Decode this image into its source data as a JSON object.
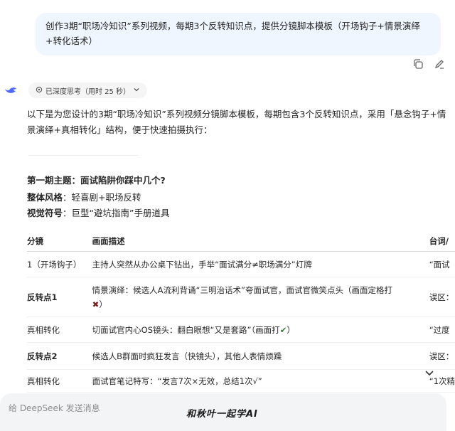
{
  "user_message": "创作3期“职场冷知识”系列视频，每期3个反转知识点，提供分镜脚本模板（开场钩子+情景演绎+转化话术）",
  "message_actions": {
    "copy_icon": "copy-icon",
    "edit_icon": "edit-icon"
  },
  "assistant": {
    "think_label": "已深度思考（用时 25 秒）",
    "intro": "以下是为您设计的3期“职场冷知识”系列视频分镜脚本模板，每期包含3个反转知识点，采用「悬念钩子+情景演绎+真相转化」结构，便于快速拍摄执行：",
    "episode_title": "第一期主题：面试陷阱你踩中几个?",
    "style_label": "整体风格",
    "style_value": "：轻喜剧+职场反转",
    "visual_label": "视觉符号",
    "visual_value": "：巨型“避坑指南”手册道具"
  },
  "table": {
    "headers": [
      "分镜",
      "画面描述",
      "台词/"
    ],
    "rows": [
      {
        "shot": "1（开场钩子）",
        "shot_bold": false,
        "scene": "主持人突然从办公桌下钻出，手举“面试满分≠职场满分”灯牌",
        "scene_mark": "",
        "scene_tail": "",
        "line": "“面试"
      },
      {
        "shot": "反转点1",
        "shot_bold": true,
        "scene": "情景演绎：候选人A流利背诵“三明治话术”夸面试官，面试官微笑点头（画面定格打",
        "scene_mark": "✖",
        "scene_tail": "）",
        "line": "误区："
      },
      {
        "shot": "真相转化",
        "shot_bold": false,
        "scene": "切面试官内心OS镜头：翻白眼想“又是套路”（画面打",
        "scene_mark": "✔",
        "scene_tail": "）",
        "line": "“过度"
      },
      {
        "shot": "反转点2",
        "shot_bold": true,
        "scene": "候选人B群面时疯狂发言（快镜头），其他人表情烦躁",
        "scene_mark": "",
        "scene_tail": "",
        "line": "误区："
      },
      {
        "shot": "真相转化",
        "shot_bold": false,
        "scene": "面试官笔记特写：“发言7次×无效，总结1次√”",
        "scene_mark": "",
        "scene_tail": "",
        "line": "“1次精"
      }
    ]
  },
  "input": {
    "placeholder": "给 DeepSeek 发送消息"
  },
  "watermark": "和秋叶一起学AI"
}
